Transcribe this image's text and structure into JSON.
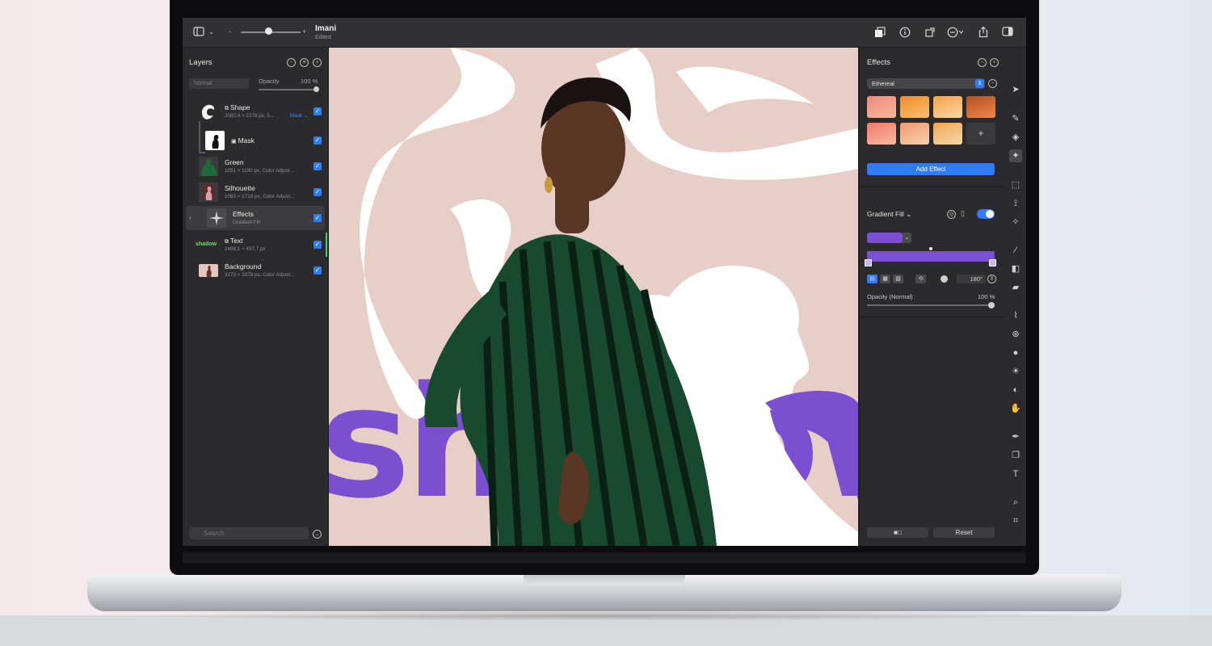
{
  "titlebar": {
    "document_title": "Imani",
    "document_status": "Edited",
    "zoom_minus": "-",
    "zoom_plus": "+"
  },
  "layers_panel": {
    "title": "Layers",
    "blend_mode": "Normal",
    "opacity_label": "Opacity",
    "opacity_value": "100 %",
    "layers": [
      {
        "name": "Shape",
        "details": "2082,4 × 2276 px, 5...",
        "mask_link": "Mask",
        "checked": true
      },
      {
        "name": "Mask",
        "details": "",
        "checked": true
      },
      {
        "name": "Green",
        "details": "1051 × 1190 px, Color Adjust...",
        "checked": true
      },
      {
        "name": "Silhouette",
        "details": "1063 × 1718 px, Color Adjust...",
        "checked": true
      },
      {
        "name": "Effects",
        "details": "Gradient Fill",
        "checked": true,
        "selected": true
      },
      {
        "name": "Text",
        "details": "2488,1 × 497,7 px",
        "thumb_text": "shadow",
        "checked": true
      },
      {
        "name": "Background",
        "details": "3273 × 1878 px, Color Adjust...",
        "checked": true
      }
    ],
    "search_placeholder": "Search"
  },
  "canvas": {
    "artwork_text": "shadow"
  },
  "effects_panel": {
    "title": "Effects",
    "preset": "Ethereal",
    "presets": [
      {
        "colors": [
          "#f08a7c",
          "#f6b79a"
        ]
      },
      {
        "colors": [
          "#f08a2a",
          "#f9c072"
        ]
      },
      {
        "colors": [
          "#f3a24a",
          "#fad7a3"
        ]
      },
      {
        "colors": [
          "#b24e26",
          "#f0874a"
        ]
      },
      {
        "colors": [
          "#f07a6a",
          "#f7b8a0"
        ]
      },
      {
        "colors": [
          "#f29a6a",
          "#f8d0b4"
        ]
      },
      {
        "colors": [
          "#f0a650",
          "#f6d7ac"
        ]
      }
    ],
    "add_swatch_label": "+",
    "add_effect_label": "Add Effect",
    "gradient_fill": {
      "title": "Gradient Fill",
      "color": "#7a4fd2",
      "angle": "180°",
      "opacity_label": "Opacity (Normal)",
      "opacity_value": "100 %",
      "enabled": true
    },
    "compare_label": "■□",
    "reset_label": "Reset"
  },
  "colors": {
    "accent": "#2f7cf6",
    "purple": "#7a4fd2",
    "canvas_bg": "#e7cfc8"
  },
  "icons": [
    "sidebar-toggle-icon",
    "layers-style-icon",
    "info-icon",
    "crop-icon",
    "more-icon",
    "share-icon",
    "sidebar-right-icon",
    "arrow-tool-icon",
    "pen-tool-icon",
    "brush-icon",
    "text-tool-icon",
    "search-icon",
    "crop-tool-icon"
  ]
}
